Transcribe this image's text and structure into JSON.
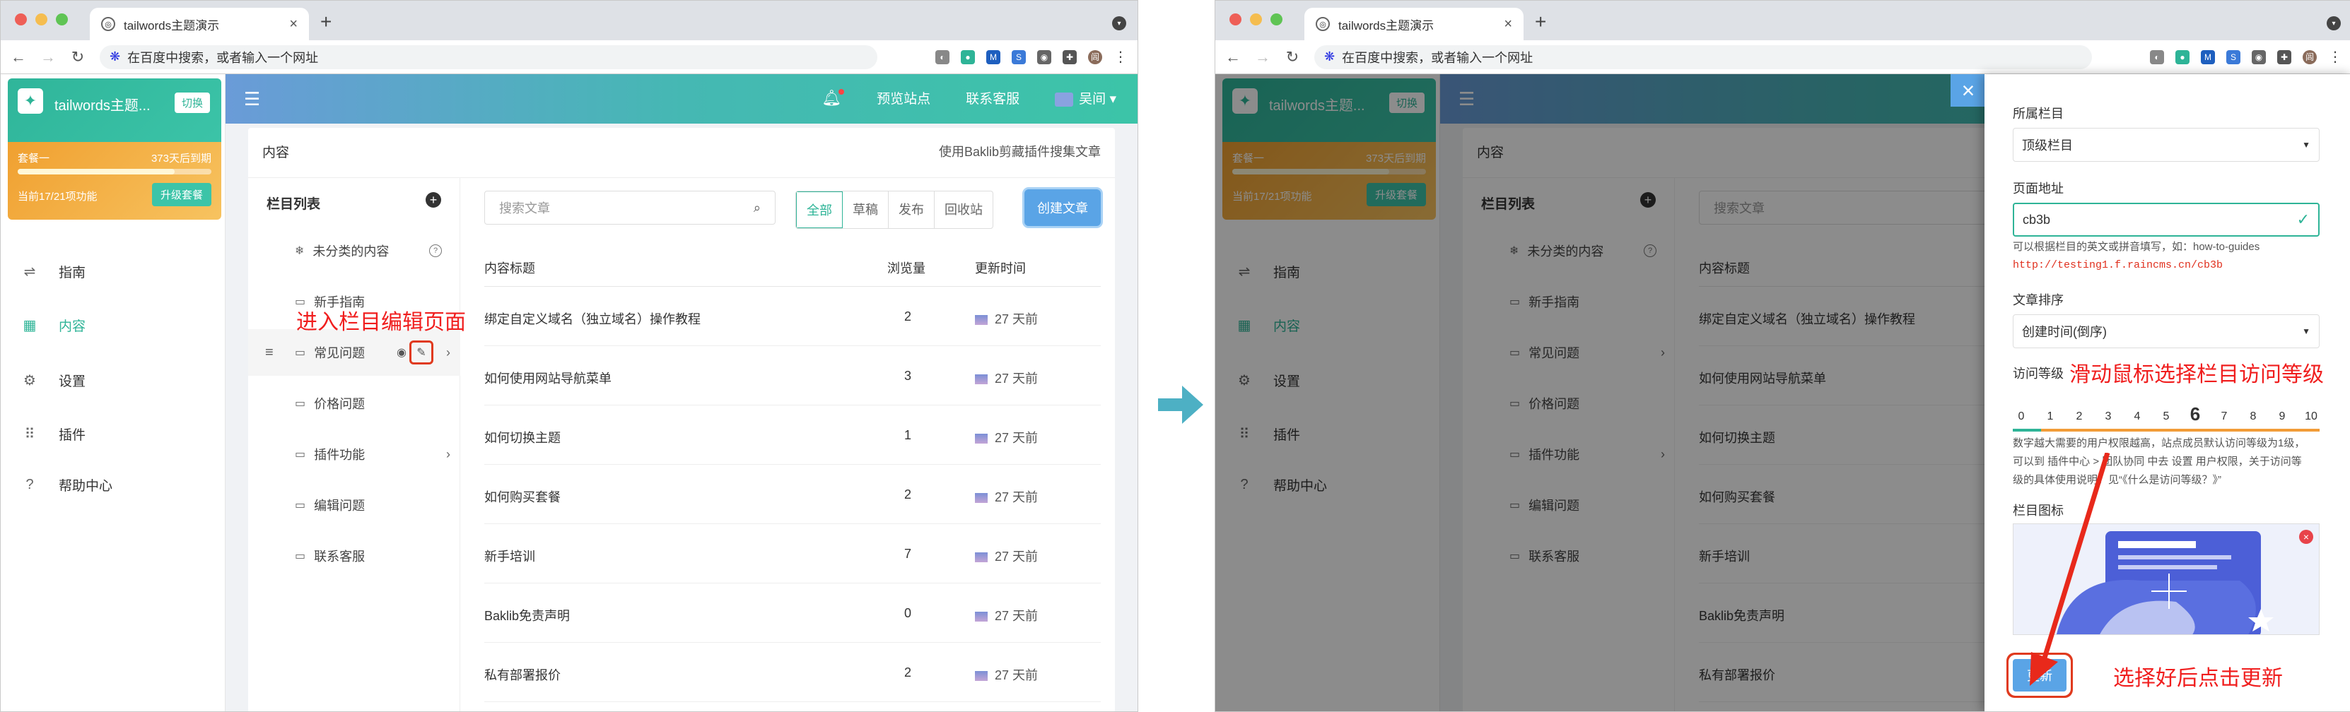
{
  "browser": {
    "tab_title": "tailwords主题演示",
    "omnibox_placeholder": "在百度中搜索，或者输入一个网址",
    "avatar_letter": "闾"
  },
  "app": {
    "brand_name": "tailwords主题...",
    "switch_label": "切换",
    "plan_name": "套餐一",
    "plan_expire": "373天后到期",
    "plan_usage": "当前17/21项功能",
    "plan_progress": 0.81,
    "upgrade_label": "升级套餐",
    "menu": [
      {
        "label": "指南",
        "icon": "sliders-icon"
      },
      {
        "label": "内容",
        "icon": "grid-icon"
      },
      {
        "label": "设置",
        "icon": "gear-icon"
      },
      {
        "label": "插件",
        "icon": "apps-icon"
      },
      {
        "label": "帮助中心",
        "icon": "help-icon"
      }
    ],
    "header": {
      "preview": "预览站点",
      "support": "联系客服",
      "user": "吴间"
    },
    "content_title": "内容",
    "content_hint": "使用Baklib剪藏插件搜集文章",
    "columns_title": "栏目列表",
    "columns": [
      {
        "label": "未分类的内容"
      },
      {
        "label": "新手指南"
      },
      {
        "label": "常见问题"
      },
      {
        "label": "价格问题"
      },
      {
        "label": "插件功能"
      },
      {
        "label": "编辑问题"
      },
      {
        "label": "联系客服"
      }
    ],
    "search_placeholder": "搜索文章",
    "filters": [
      "全部",
      "草稿",
      "发布",
      "回收站"
    ],
    "create_label": "创建文章",
    "table_headers": {
      "title": "内容标题",
      "views": "浏览量",
      "updated": "更新时间"
    },
    "articles": [
      {
        "title": "绑定自定义域名（独立域名）操作教程",
        "views": "2",
        "updated": "27 天前"
      },
      {
        "title": "如何使用网站导航菜单",
        "views": "3",
        "updated": "27 天前"
      },
      {
        "title": "如何切换主题",
        "views": "1",
        "updated": "27 天前"
      },
      {
        "title": "如何购买套餐",
        "views": "2",
        "updated": "27 天前"
      },
      {
        "title": "新手培训",
        "views": "7",
        "updated": "27 天前"
      },
      {
        "title": "Baklib免责声明",
        "views": "0",
        "updated": "27 天前"
      },
      {
        "title": "私有部署报价",
        "views": "2",
        "updated": "27 天前"
      }
    ]
  },
  "annotations": {
    "left": "进入栏目编辑页面",
    "access": "滑动鼠标选择栏目访问等级",
    "update": "选择好后点击更新"
  },
  "drawer": {
    "parent_label": "所属栏目",
    "parent_value": "顶级栏目",
    "path_label": "页面地址",
    "path_value": "cb3b",
    "path_help": "可以根据栏目的英文或拼音填写，如：how-to-guides",
    "path_url": "http://testing1.f.raincms.cn/cb3b",
    "sort_label": "文章排序",
    "sort_value": "创建时间(倒序)",
    "access_label": "访问等级",
    "access_levels": [
      "0",
      "1",
      "2",
      "3",
      "4",
      "5",
      "6",
      "7",
      "8",
      "9",
      "10"
    ],
    "access_selected": 6,
    "access_help_1": "数字越大需要的用户权限越高，站点成员默认访问等级为1级，",
    "access_help_2": "可以到 插件中心 > 团队协同 中去 设置 用户权限，关于访问等",
    "access_help_3": "级的具体使用说明，见“《什么是访问等级？》”",
    "icon_label": "栏目图标",
    "update_label": "更新"
  }
}
